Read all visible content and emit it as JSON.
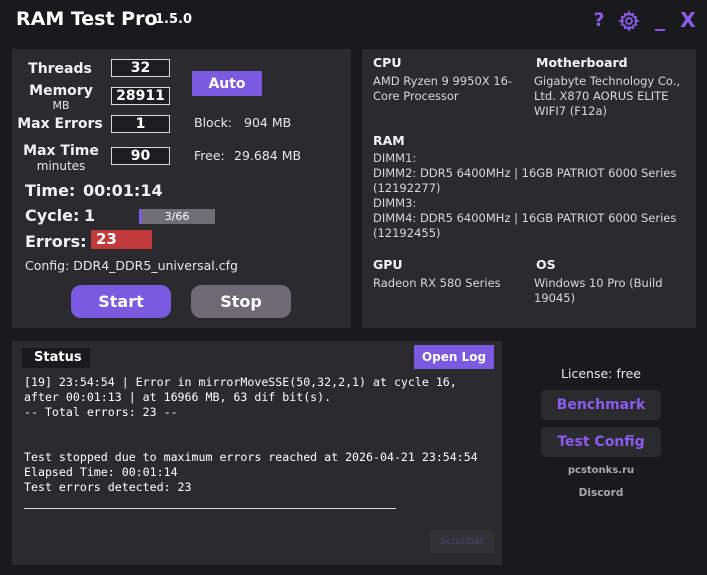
{
  "app": {
    "title": "RAM Test Pro",
    "version": "1.5.0"
  },
  "colors": {
    "accent": "#7a5ae0",
    "error": "#c0393b",
    "background": "#1a1a1d",
    "panel": "#2a2a2f"
  },
  "titlebar": {
    "help_icon": "?",
    "settings_icon": "gear-icon",
    "minimize_icon": "_",
    "close_icon": "X"
  },
  "settings": {
    "threads_label": "Threads",
    "threads_value": "32",
    "memory_label": "Memory",
    "memory_unit": "MB",
    "memory_value": "28911",
    "max_errors_label": "Max Errors",
    "max_errors_value": "1",
    "max_time_label": "Max Time",
    "max_time_unit": "minutes",
    "max_time_value": "90",
    "auto_button": "Auto",
    "block_label": "Block:",
    "block_value": "904 MB",
    "free_label": "Free:",
    "free_value": "29.684 MB"
  },
  "run": {
    "time_label": "Time:",
    "time_value": "00:01:14",
    "cycle_label": "Cycle:",
    "cycle_value": "1",
    "progress_text": "3/66",
    "progress_fraction": 0.045,
    "errors_label": "Errors:",
    "errors_value": "23",
    "config_text": "Config: DDR4_DDR5_universal.cfg",
    "start_button": "Start",
    "stop_button": "Stop"
  },
  "system": {
    "cpu_title": "CPU",
    "cpu_value": "AMD Ryzen 9 9950X 16-\nCore Processor",
    "mb_title": "Motherboard",
    "mb_value": "Gigabyte Technology Co.,\nLtd. X870 AORUS ELITE\nWIFI7 (F12a)",
    "ram_title": "RAM",
    "ram_value": "DIMM1:\nDIMM2: DDR5 6400MHz | 16GB PATRIOT 6000 Series\n(12192277)\nDIMM3:\nDIMM4: DDR5 6400MHz | 16GB PATRIOT 6000 Series\n(12192455)",
    "gpu_title": "GPU",
    "gpu_value": "Radeon RX 580 Series",
    "os_title": "OS",
    "os_value": "Windows 10 Pro (Build\n19045)"
  },
  "status": {
    "title": "Status",
    "open_log_button": "Open Log",
    "log_text": "[19] 23:54:54 | Error in mirrorMoveSSE(50,32,2,1) at cycle 16,\nafter 00:01:13 | at 16966 MB, 63 dif bit(s).\n-- Total errors: 23 --\n\n\nTest stopped due to maximum errors reached at 2026-04-21 23:54:54\nElapsed Time: 00:01:14\nTest errors detected: 23",
    "scrollbar_label": "Scrollbar"
  },
  "sidebar": {
    "license_text": "License: free",
    "benchmark_button": "Benchmark",
    "test_config_button": "Test Config",
    "website_link": "pcstonks.ru",
    "discord_link": "Discord"
  }
}
